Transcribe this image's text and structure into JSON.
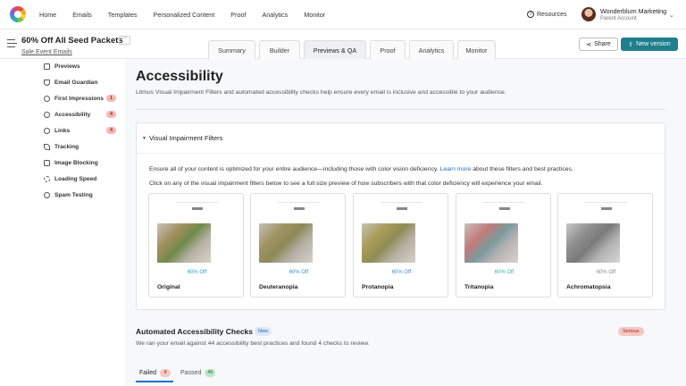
{
  "topnav": {
    "links": [
      "Home",
      "Emails",
      "Templates",
      "Personalized Content",
      "Proof",
      "Analytics",
      "Monitor"
    ],
    "resources": "Resources",
    "account_name": "Wonderblum Marketing",
    "account_sub": "Parent Account"
  },
  "header": {
    "title": "60% Off All Seed Packets",
    "more": "···",
    "sublink": "Sale Event Emails",
    "tabs": [
      "Summary",
      "Builder",
      "Previews & QA",
      "Proof",
      "Analytics",
      "Monitor"
    ],
    "active_tab": "Previews & QA",
    "share": "Share",
    "new_version": "New version"
  },
  "sidebar": {
    "items": [
      {
        "label": "Previews",
        "icon": "monitor-icon"
      },
      {
        "label": "Email Guardian",
        "icon": "shield-icon"
      },
      {
        "label": "First Impressions",
        "icon": "eye-icon",
        "badge": "1"
      },
      {
        "label": "Accessibility",
        "icon": "accessibility-icon",
        "badge": "4"
      },
      {
        "label": "Links",
        "icon": "link-icon",
        "badge": "4"
      },
      {
        "label": "Tracking",
        "icon": "send-icon"
      },
      {
        "label": "Image Blocking",
        "icon": "image-icon"
      },
      {
        "label": "Loading Speed",
        "icon": "speed-icon"
      },
      {
        "label": "Spam Testing",
        "icon": "spam-icon"
      }
    ]
  },
  "main": {
    "title": "Accessibility",
    "intro": "Litmus Visual Impairment Filters and automated accessibility checks help ensure every email is inclusive and accessible to your audience.",
    "panel": {
      "title": "Visual Impairment Filters",
      "p1_before": "Ensure all of your content is optimized for your entire audience—including those with color vision deficiency.",
      "p1_link": "Learn more",
      "p1_after": "about these filters and best practices.",
      "p2": "Click on any of the visual impairment filters below to see a full size preview of how subscribers with that color deficiency will experience your email.",
      "cards": [
        {
          "name": "Original",
          "offer": "60% Off",
          "offer_color": "#2a9fd6"
        },
        {
          "name": "Deuteranopia",
          "offer": "60% Off",
          "offer_color": "#3a8fd0"
        },
        {
          "name": "Protanopia",
          "offer": "60% Off",
          "offer_color": "#4a8ed3"
        },
        {
          "name": "Tritanopia",
          "offer": "60% Off",
          "offer_color": "#2fb3b0"
        },
        {
          "name": "Achromatopsia",
          "offer": "60% Off",
          "offer_color": "#888888"
        }
      ]
    },
    "auto": {
      "title": "Automated Accessibility Checks",
      "new_badge": "New",
      "serious_badge": "Serious",
      "subtitle": "We ran your email against 44 accessibility best practices and found 4 checks to review.",
      "failed_label": "Failed",
      "failed_count": "4",
      "passed_label": "Passed",
      "passed_count": "40"
    }
  },
  "colors": {
    "accent": "#1f7f8c",
    "link": "#1f6fd1"
  }
}
